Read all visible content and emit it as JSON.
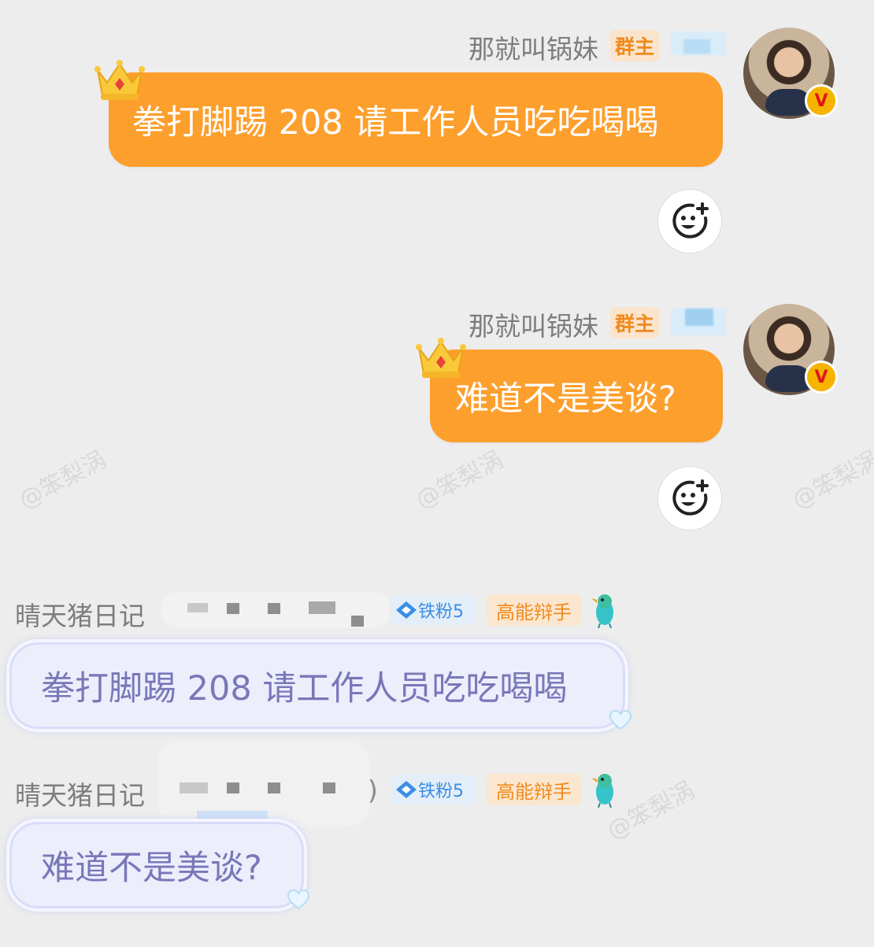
{
  "watermark": "@笨梨涡",
  "messages": [
    {
      "sender": "那就叫锅妹",
      "badge": "群主",
      "text": "拳打脚踢 208 请工作人员吃吃喝喝"
    },
    {
      "sender": "那就叫锅妹",
      "badge": "群主",
      "text": "难道不是美谈?"
    },
    {
      "sender": "晴天猪日记",
      "fan_badge": "铁粉5",
      "rank_badge": "高能辩手",
      "text": "拳打脚踢 208 请工作人员吃吃喝喝"
    },
    {
      "sender": "晴天猪日记",
      "paren_close": ")",
      "fan_badge": "铁粉5",
      "rank_badge": "高能辩手",
      "text": "难道不是美谈?"
    }
  ],
  "verified_mark": "V",
  "icons": {
    "reaction": "add-emoji-icon",
    "crown": "crown-icon",
    "heart": "heart-icon",
    "bird": "bird-icon",
    "fan": "diamond-icon"
  },
  "colors": {
    "background": "#ededed",
    "orange_bubble": "#fd9f2d",
    "lilac_bubble": "#eceefc",
    "owner_badge": "#f08a1c",
    "fan_badge": "#3a8ee6"
  }
}
